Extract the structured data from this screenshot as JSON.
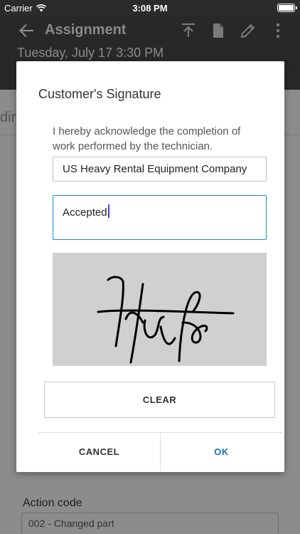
{
  "status_bar": {
    "carrier": "Carrier",
    "time": "3:08 PM"
  },
  "header": {
    "title": "Assignment",
    "subtitle": "Tuesday, July 17 3:30 PM",
    "icons": [
      "arrow-left-icon",
      "upload-icon",
      "document-icon",
      "pencil-icon",
      "more-vertical-icon"
    ]
  },
  "background": {
    "fragment": "din",
    "action_code_label": "Action code",
    "action_code_value": "002 - Changed part"
  },
  "dialog": {
    "title": "Customer's Signature",
    "acknowledgement": "I hereby acknowledge the completion of work performed by the technician.",
    "company_value": "US Heavy Rental Equipment Company",
    "notes_value": "Accepted",
    "clear_label": "CLEAR",
    "cancel_label": "CANCEL",
    "ok_label": "OK"
  },
  "colors": {
    "accent": "#1a73b8",
    "focus_border": "#1a8ccb",
    "overlay": "#8c8c8c"
  }
}
